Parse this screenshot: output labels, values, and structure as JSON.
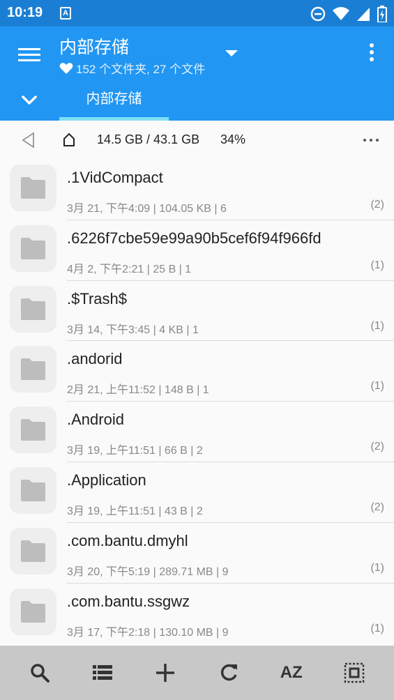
{
  "status_bar": {
    "time": "10:19",
    "notification_badge": "A",
    "icons": [
      "do-not-disturb-icon",
      "wifi-icon",
      "signal-icon",
      "battery-charging-icon"
    ]
  },
  "app_bar": {
    "title": "内部存储",
    "subtitle": "152 个文件夹, 27 个文件",
    "tab_label": "内部存储",
    "colors": {
      "appbar": "#2196f3",
      "statusbar": "#1a7fd4",
      "tab_indicator": "#7ee0f3"
    }
  },
  "path_bar": {
    "storage_used": "14.5 GB / 43.1 GB",
    "storage_percent": "34%"
  },
  "files": [
    {
      "name": ".1VidCompact",
      "meta": "3月 21, 下午4:09 | 104.05  KB | 6",
      "count": "(2)"
    },
    {
      "name": ".6226f7cbe59e99a90b5cef6f94f966fd",
      "meta": "4月 2, 下午2:21 | 25 B | 1",
      "count": "(1)"
    },
    {
      "name": ".$Trash$",
      "meta": "3月 14, 下午3:45 | 4  KB | 1",
      "count": "(1)"
    },
    {
      "name": ".andorid",
      "meta": "2月 21, 上午11:52 | 148 B | 1",
      "count": "(1)"
    },
    {
      "name": ".Android",
      "meta": "3月 19, 上午11:51 | 66 B | 2",
      "count": "(2)"
    },
    {
      "name": ".Application",
      "meta": "3月 19, 上午11:51 | 43 B | 2",
      "count": "(2)"
    },
    {
      "name": ".com.bantu.dmyhl",
      "meta": "3月 20, 下午5:19 | 289.71 MB | 9",
      "count": "(1)"
    },
    {
      "name": ".com.bantu.ssgwz",
      "meta": "3月 17, 下午2:18 | 130.10 MB | 9",
      "count": "(1)"
    }
  ],
  "toolbar": {
    "sort_label": "AZ",
    "icons": [
      "search-icon",
      "list-view-icon",
      "add-icon",
      "refresh-icon",
      "sort-az-icon",
      "select-all-icon"
    ]
  }
}
